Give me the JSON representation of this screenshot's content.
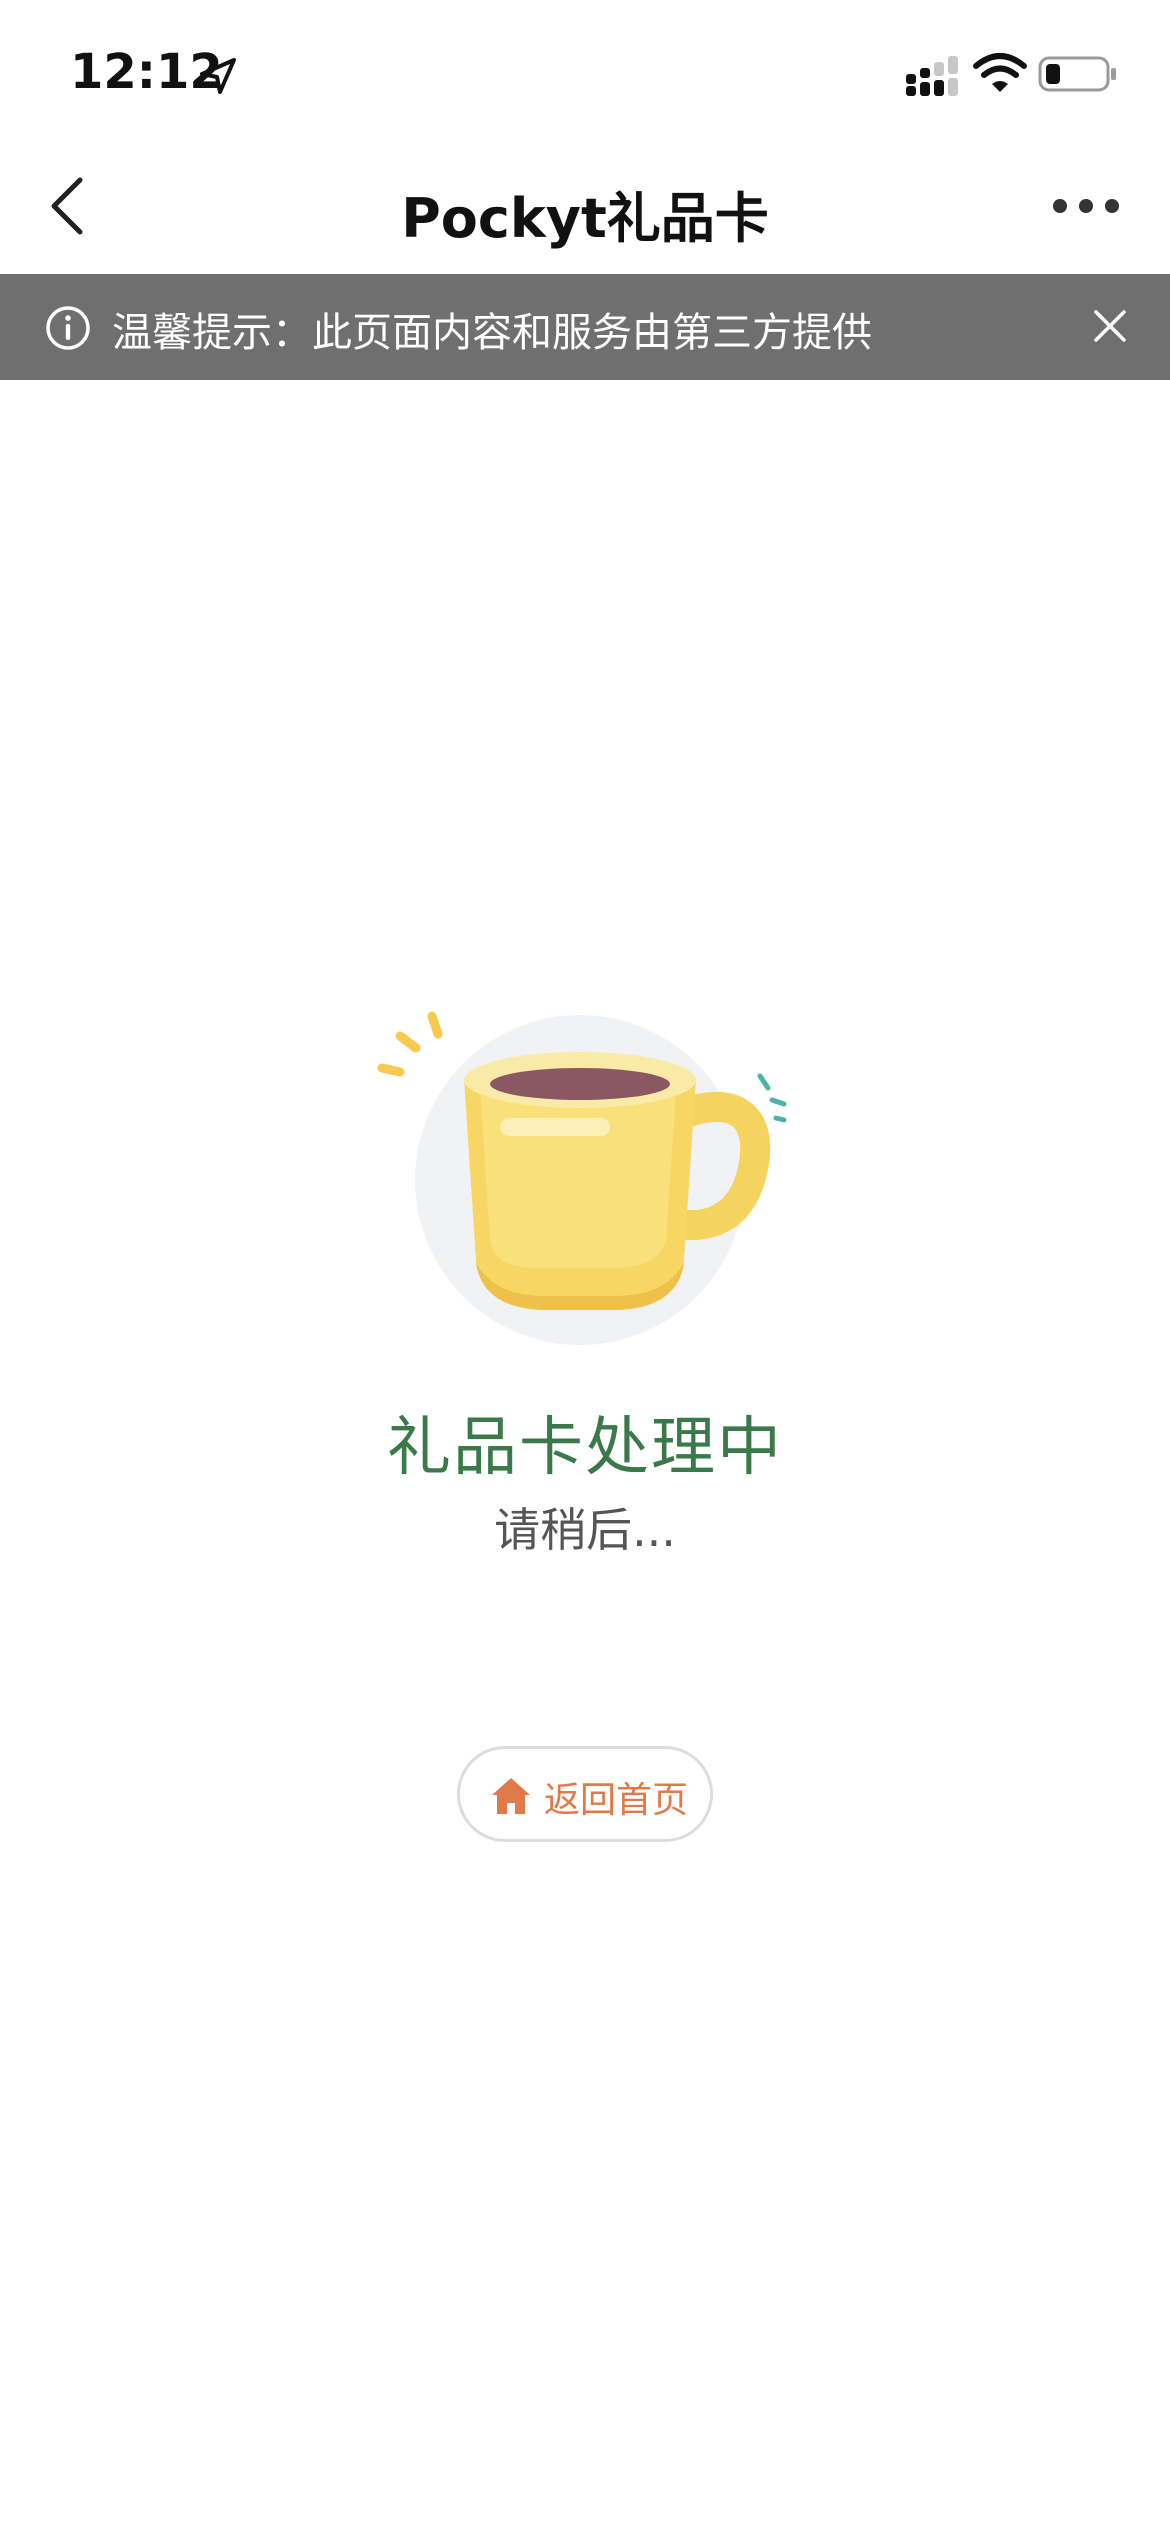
{
  "status_bar": {
    "time": "12:12",
    "icons": [
      "location-arrow-icon",
      "signal-icon",
      "wifi-icon",
      "battery-icon"
    ]
  },
  "nav_bar": {
    "title": "Pockyt礼品卡",
    "back_icon": "chevron-left-icon",
    "more_icon": "more-dots-icon"
  },
  "notice": {
    "text": "温馨提示：此页面内容和服务由第三方提供",
    "info_icon": "info-circle-icon",
    "close_icon": "close-icon",
    "background": "#6f6f6f"
  },
  "main": {
    "illustration": "coffee-cup-icon",
    "title": "礼品卡处理中",
    "subtitle": "请稍后...",
    "home_button": {
      "label": "返回首页",
      "icon": "home-icon"
    }
  },
  "colors": {
    "title_green": "#3a7a4a",
    "button_orange": "#e07a4a",
    "cup_yellow": "#f7d664"
  }
}
